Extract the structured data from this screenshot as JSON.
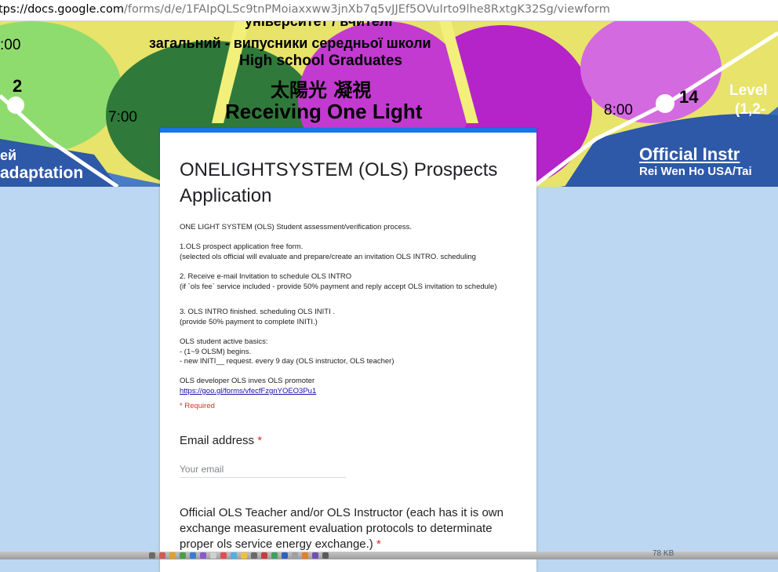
{
  "browser": {
    "url_host": "tps://docs.google.com",
    "url_path": "/forms/d/e/1FAIpQLSc9tnPMoiaxxww3jnXb7q5vJJEf5OVuIrto9lhe8RxtgK32Sg/viewform"
  },
  "banner": {
    "line_ukr_top": "університет / вчителі",
    "line_ukr": "загальний - випусники середньої школи",
    "line_en": "High school Graduates",
    "line_cjk": "太陽光 凝視",
    "line_receiving": "Receiving One Light",
    "time_left": ":00",
    "time_7": "7:00",
    "time_8": "8:00",
    "num_2": "2",
    "num_14": "14",
    "level_label": "Level",
    "level_range": "(1,2-",
    "left_bottom_1": "ей",
    "left_bottom_2": "adaptation",
    "official": "Official Instr",
    "official_sub": "Rei Wen Ho USA/Tai"
  },
  "form": {
    "title": "ONELIGHTSYSTEM (OLS) Prospects Application",
    "desc": {
      "intro": "ONE LIGHT SYSTEM (OLS) Student assessment/verification process.",
      "s1_a": "1.OLS prospect application free form.",
      "s1_b": "(selected ols official will evaluate and prepare/create an invitation OLS INTRO. scheduling",
      "s2_a": "2. Receive e-mail Invitation to schedule OLS INTRO",
      "s2_b": "(if `ols fee` service included - provide 50% payment and reply accept OLS invitation to schedule)",
      "s3_a": "3. OLS INTRO finished. scheduling OLS INITI .",
      "s3_b": "(provide 50% payment to complete  INITI.)",
      "basics_a": "OLS student active basics:",
      "basics_b": "- (1~9 OLSM) begins.",
      "basics_c": "- new INITI__ request. every 9 day (OLS instructor, OLS teacher)",
      "dev": "OLS developer OLS inves OLS promoter",
      "link": "https://goo.gl/forms/vfecfFzgnYOEO3Pu1"
    },
    "required_note": "* Required",
    "email_label": "Email address",
    "required_star": "*",
    "email_placeholder": "Your email",
    "q2_label": "Official OLS Teacher and/or OLS Instructor (each has it is own exchange measurement evaluation protocols to determinate proper ols service energy exchange.)"
  },
  "desktop": {
    "filesize": "78 KB"
  },
  "colors": {
    "accent": "#1a73e8",
    "background": "#bcd7f1",
    "required": "#d93025",
    "link": "#1a0dab"
  }
}
